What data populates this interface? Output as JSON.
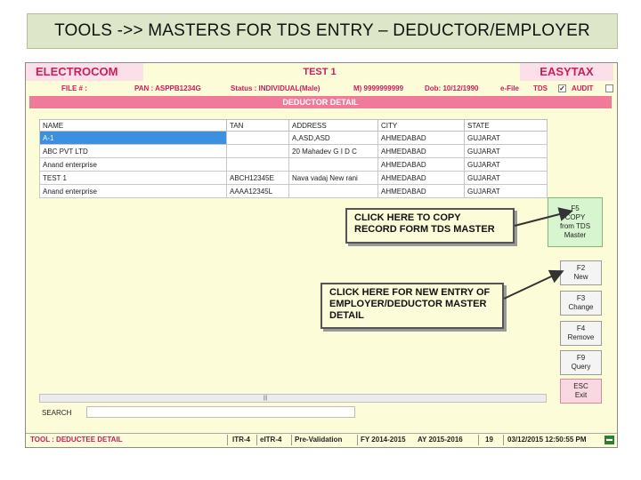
{
  "slide": {
    "title": "TOOLS ->> MASTERS FOR TDS ENTRY – DEDUCTOR/EMPLOYER"
  },
  "app": {
    "brand_left": "ELECTROCOM",
    "window_title": "TEST 1",
    "brand_right": "EASYTAX"
  },
  "infobar": {
    "file_no": "FILE # :",
    "pan": "PAN : ASPPB1234G",
    "status": "Status : INDIVIDUAL(Male)",
    "mobile": "M) 9999999999",
    "dob": "Dob: 10/12/1990",
    "efile": "e-File",
    "tds": "TDS",
    "audit": "AUDIT"
  },
  "section": {
    "title": "DEDUCTOR DETAIL"
  },
  "grid": {
    "columns": [
      "NAME",
      "TAN",
      "ADDRESS",
      "CITY",
      "STATE"
    ],
    "rows": [
      [
        "A-1",
        "",
        "A,ASD,ASD",
        "AHMEDABAD",
        "GUJARAT"
      ],
      [
        "ABC PVT LTD",
        "",
        "20 Mahadev G I D C",
        "AHMEDABAD",
        "GUJARAT"
      ],
      [
        "Anand enterprise",
        "",
        "",
        "AHMEDABAD",
        "GUJARAT"
      ],
      [
        "TEST 1",
        "ABCH12345E",
        "Nava vadaj New rani",
        "AHMEDABAD",
        "GUJARAT"
      ],
      [
        "Anand enterprise",
        "AAAA12345L",
        "",
        "AHMEDABAD",
        "GUJARAT"
      ]
    ]
  },
  "search": {
    "label": "SEARCH"
  },
  "buttons": {
    "copy": [
      "F5",
      "COPY",
      "from TDS",
      "Master"
    ],
    "new": [
      "F2",
      "New"
    ],
    "change": [
      "F3",
      "Change"
    ],
    "remove": [
      "F4",
      "Remove"
    ],
    "query": [
      "F9",
      "Query"
    ],
    "exit": [
      "ESC",
      "Exit"
    ]
  },
  "callouts": {
    "copy": "CLICK HERE TO COPY RECORD FORM TDS MASTER",
    "new": "CLICK HERE FOR NEW ENTRY OF EMPLOYER/DEDUCTOR MASTER DETAIL"
  },
  "statusbar": {
    "tool": "TOOL : DEDUCTEE DETAIL",
    "itr4": "ITR-4",
    "eitr4": "eITR-4",
    "prevalidation": "Pre-Validation",
    "fy": "FY 2014-2015",
    "ay": "AY 2015-2016",
    "count": "19",
    "datetime": "03/12/2015 12:50:55 PM"
  }
}
